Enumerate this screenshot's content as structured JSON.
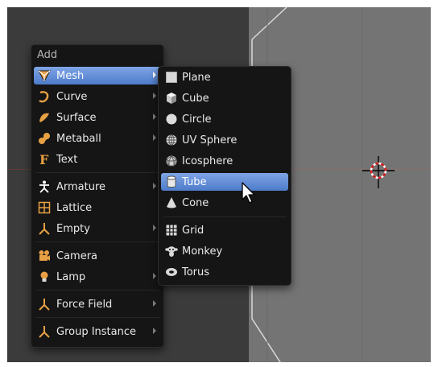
{
  "menu": {
    "title": "Add",
    "items": [
      {
        "label": "Mesh",
        "icon": "mesh-icon",
        "has_submenu": true,
        "selected": true
      },
      {
        "label": "Curve",
        "icon": "curve-icon",
        "has_submenu": true
      },
      {
        "label": "Surface",
        "icon": "surface-icon",
        "has_submenu": true
      },
      {
        "label": "Metaball",
        "icon": "metaball-icon",
        "has_submenu": true
      },
      {
        "label": "Text",
        "icon": "text-icon",
        "has_submenu": false
      },
      {
        "label": "Armature",
        "icon": "armature-icon",
        "has_submenu": true
      },
      {
        "label": "Lattice",
        "icon": "lattice-icon",
        "has_submenu": false
      },
      {
        "label": "Empty",
        "icon": "empty-icon",
        "has_submenu": true
      },
      {
        "label": "Camera",
        "icon": "camera-icon",
        "has_submenu": false
      },
      {
        "label": "Lamp",
        "icon": "lamp-icon",
        "has_submenu": true
      },
      {
        "label": "Force Field",
        "icon": "force-field-icon",
        "has_submenu": true
      },
      {
        "label": "Group Instance",
        "icon": "group-instance-icon",
        "has_submenu": true
      }
    ]
  },
  "submenu": {
    "items": [
      {
        "label": "Plane",
        "icon": "plane-icon"
      },
      {
        "label": "Cube",
        "icon": "cube-icon"
      },
      {
        "label": "Circle",
        "icon": "circle-icon"
      },
      {
        "label": "UV Sphere",
        "icon": "uv-sphere-icon"
      },
      {
        "label": "Icosphere",
        "icon": "icosphere-icon"
      },
      {
        "label": "Tube",
        "icon": "tube-icon",
        "selected": true
      },
      {
        "label": "Cone",
        "icon": "cone-icon"
      },
      {
        "label": "Grid",
        "icon": "grid-icon"
      },
      {
        "label": "Monkey",
        "icon": "monkey-icon"
      },
      {
        "label": "Torus",
        "icon": "torus-icon"
      }
    ]
  },
  "colors": {
    "menu_background": "#151515",
    "selection_blue": "#5f8ed8",
    "orange_icon": "#e7a144",
    "viewport_dark": "#3b3b3b",
    "viewport_object": "#747474"
  }
}
